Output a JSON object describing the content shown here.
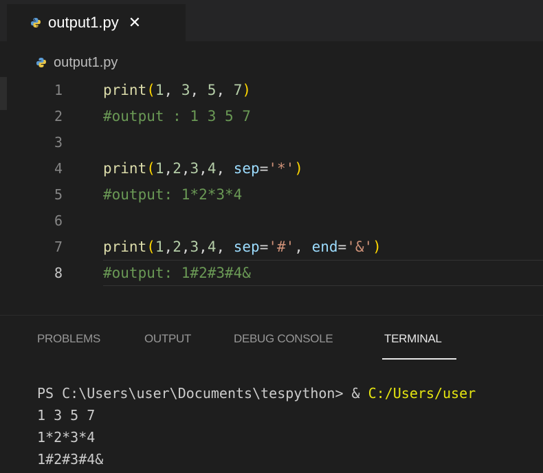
{
  "tab": {
    "label": "output1.py",
    "close": "✕"
  },
  "breadcrumb": {
    "label": "output1.py"
  },
  "editor": {
    "active_line": 8,
    "lines": [
      {
        "n": "1",
        "tokens": [
          [
            "kw",
            "print"
          ],
          [
            "paren",
            "("
          ],
          [
            "num",
            "1"
          ],
          [
            "plain",
            ", "
          ],
          [
            "num",
            "3"
          ],
          [
            "plain",
            ", "
          ],
          [
            "num",
            "5"
          ],
          [
            "plain",
            ", "
          ],
          [
            "num",
            "7"
          ],
          [
            "paren",
            ")"
          ]
        ]
      },
      {
        "n": "2",
        "tokens": [
          [
            "cmt",
            "#output : 1 3 5 7"
          ]
        ]
      },
      {
        "n": "3",
        "tokens": []
      },
      {
        "n": "4",
        "tokens": [
          [
            "kw",
            "print"
          ],
          [
            "paren",
            "("
          ],
          [
            "num",
            "1"
          ],
          [
            "plain",
            ","
          ],
          [
            "num",
            "2"
          ],
          [
            "plain",
            ","
          ],
          [
            "num",
            "3"
          ],
          [
            "plain",
            ","
          ],
          [
            "num",
            "4"
          ],
          [
            "plain",
            ", "
          ],
          [
            "param",
            "sep"
          ],
          [
            "plain",
            "="
          ],
          [
            "str",
            "'*'"
          ],
          [
            "paren",
            ")"
          ]
        ]
      },
      {
        "n": "5",
        "tokens": [
          [
            "cmt",
            "#output: 1*2*3*4"
          ]
        ]
      },
      {
        "n": "6",
        "tokens": []
      },
      {
        "n": "7",
        "tokens": [
          [
            "kw",
            "print"
          ],
          [
            "paren",
            "("
          ],
          [
            "num",
            "1"
          ],
          [
            "plain",
            ","
          ],
          [
            "num",
            "2"
          ],
          [
            "plain",
            ","
          ],
          [
            "num",
            "3"
          ],
          [
            "plain",
            ","
          ],
          [
            "num",
            "4"
          ],
          [
            "plain",
            ", "
          ],
          [
            "param",
            "sep"
          ],
          [
            "plain",
            "="
          ],
          [
            "str",
            "'#'"
          ],
          [
            "plain",
            ", "
          ],
          [
            "param",
            "end"
          ],
          [
            "plain",
            "="
          ],
          [
            "str",
            "'&'"
          ],
          [
            "paren",
            ")"
          ]
        ]
      },
      {
        "n": "8",
        "tokens": [
          [
            "cmt",
            "#output: 1#2#3#4&"
          ]
        ]
      }
    ]
  },
  "panel": {
    "tabs": [
      "PROBLEMS",
      "OUTPUT",
      "DEBUG CONSOLE",
      "TERMINAL"
    ],
    "active_tab": "TERMINAL"
  },
  "terminal": {
    "prompt": "PS C:\\Users\\user\\Documents\\tespython> & ",
    "command_path": "C:/Users/user",
    "output": [
      "1 3 5 7",
      "1*2*3*4",
      "1#2#3#4&"
    ]
  },
  "colors": {
    "editor_bg": "#1e1e1e",
    "keyword": "#dcdcaa",
    "bracket": "#ffd700",
    "number": "#b5cea8",
    "string": "#ce9178",
    "parameter": "#9cdcfe",
    "comment": "#6a9955",
    "terminal_path": "#e5e510"
  },
  "icons": {
    "file": "python-icon",
    "close": "close-icon"
  }
}
